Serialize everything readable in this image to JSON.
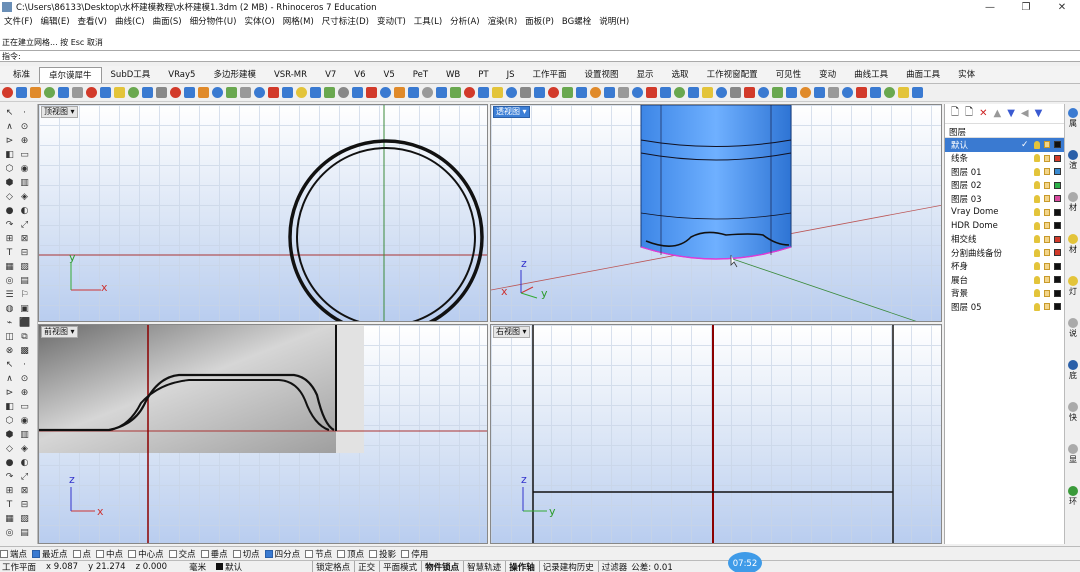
{
  "window": {
    "title": "C:\\Users\\86133\\Desktop\\水杯建模教程\\水杯建模1.3dm (2 MB) - Rhinoceros 7 Education",
    "controls": [
      "—",
      "❐",
      "✕"
    ]
  },
  "menu": [
    "文件(F)",
    "编辑(E)",
    "查看(V)",
    "曲线(C)",
    "曲面(S)",
    "细分物件(U)",
    "实体(O)",
    "网格(M)",
    "尺寸标注(D)",
    "变动(T)",
    "工具(L)",
    "分析(A)",
    "渲染(R)",
    "面板(P)",
    "BG螺栓",
    "说明(H)"
  ],
  "command": {
    "history_line1": "",
    "history_line2": "正在建立网格... 按 Esc 取消",
    "prompt": "指令:"
  },
  "tabs": [
    "标准",
    "卓尔谟犀牛",
    "SubD工具",
    "VRay5",
    "多边形建模",
    "VSR-MR",
    "V7",
    "V6",
    "V5",
    "PeT",
    "WB",
    "PT",
    "JS",
    "工作平面",
    "设置视图",
    "显示",
    "选取",
    "工作视窗配置",
    "可见性",
    "变动",
    "曲线工具",
    "曲面工具",
    "实体"
  ],
  "active_tab_index": 1,
  "toolbar_icon_colors": [
    "#d23a2a",
    "#3a7ad1",
    "#e08a2a",
    "#6aa84f",
    "#3a7ad1",
    "#999999",
    "#d23a2a",
    "#3a7ad1",
    "#e3c43a",
    "#6aa84f",
    "#3a7ad1",
    "#888888",
    "#d23a2a",
    "#3a7ad1",
    "#e08a2a",
    "#3a7ad1",
    "#6aa84f",
    "#999999",
    "#3a7ad1",
    "#d23a2a",
    "#3a7ad1",
    "#e3c43a",
    "#3a7ad1",
    "#6aa84f",
    "#888888",
    "#3a7ad1",
    "#d23a2a",
    "#3a7ad1",
    "#e08a2a",
    "#3a7ad1",
    "#999999",
    "#3a7ad1",
    "#6aa84f",
    "#d23a2a",
    "#3a7ad1",
    "#e3c43a",
    "#3a7ad1",
    "#888888",
    "#3a7ad1",
    "#d23a2a",
    "#6aa84f",
    "#3a7ad1",
    "#e08a2a",
    "#3a7ad1",
    "#999999",
    "#3a7ad1",
    "#d23a2a",
    "#3a7ad1",
    "#6aa84f",
    "#3a7ad1",
    "#e3c43a",
    "#3a7ad1",
    "#888888",
    "#d23a2a",
    "#3a7ad1",
    "#6aa84f",
    "#3a7ad1",
    "#e08a2a",
    "#3a7ad1",
    "#999999",
    "#3a7ad1",
    "#d23a2a",
    "#3a7ad1",
    "#6aa84f",
    "#e3c43a",
    "#3a7ad1"
  ],
  "viewports": {
    "top": {
      "label": "顶视图",
      "axis_y": "y",
      "axis_x": "x"
    },
    "perspective": {
      "label": "透视图",
      "axis_z": "z",
      "axis_x": "x",
      "axis_y": "y"
    },
    "front": {
      "label": "前视图",
      "axis_z": "z",
      "axis_x": "x"
    },
    "right": {
      "label": "右视图",
      "axis_z": "z",
      "axis_y": "y"
    }
  },
  "layers": {
    "title": "图层",
    "rows": [
      {
        "name": "默认",
        "color": "#111111",
        "current": true
      },
      {
        "name": "线条",
        "color": "#d23a2a"
      },
      {
        "name": "图层 01",
        "color": "#3a8ad1"
      },
      {
        "name": "图层 02",
        "color": "#2db04a"
      },
      {
        "name": "图层 03",
        "color": "#d94aa0"
      },
      {
        "name": "Vray Dome",
        "color": "#111111"
      },
      {
        "name": "HDR Dome",
        "color": "#111111"
      },
      {
        "name": "相交线",
        "color": "#d23a2a"
      },
      {
        "name": "分割曲线备份",
        "color": "#d23a2a"
      },
      {
        "name": "杯身",
        "color": "#111111"
      },
      {
        "name": "展台",
        "color": "#111111"
      },
      {
        "name": "背景",
        "color": "#111111"
      },
      {
        "name": "图层 05",
        "color": "#111111"
      }
    ]
  },
  "side_tabs": [
    "属",
    "渲",
    "材",
    "材",
    "灯",
    "说",
    "底",
    "快",
    "显",
    "环"
  ],
  "osnap": [
    {
      "label": "端点",
      "on": false
    },
    {
      "label": "最近点",
      "on": true
    },
    {
      "label": "点",
      "on": false
    },
    {
      "label": "中点",
      "on": false
    },
    {
      "label": "中心点",
      "on": false
    },
    {
      "label": "交点",
      "on": false
    },
    {
      "label": "垂点",
      "on": false
    },
    {
      "label": "切点",
      "on": false
    },
    {
      "label": "四分点",
      "on": true
    },
    {
      "label": "节点",
      "on": false
    },
    {
      "label": "顶点",
      "on": false
    },
    {
      "label": "投影",
      "on": false
    },
    {
      "label": "停用",
      "on": false
    }
  ],
  "status": {
    "cplane": "工作平面",
    "x": "x 9.087",
    "y": "y 21.274",
    "z": "z 0.000",
    "units": "毫米",
    "layer": "默认",
    "buttons": [
      "锁定格点",
      "正交",
      "平面模式",
      "物件锁点",
      "智慧轨迹",
      "操作轴",
      "记录建构历史",
      "过滤器"
    ],
    "bold_buttons": [
      "物件锁点",
      "操作轴"
    ],
    "tolerance": "公差: 0.01",
    "clock": "07:52"
  }
}
